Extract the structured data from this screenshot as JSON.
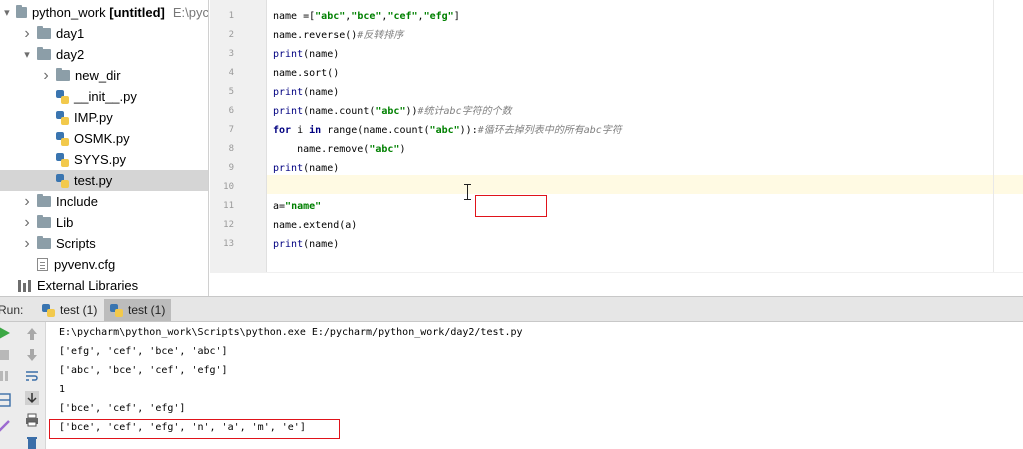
{
  "project": {
    "root_name": "python_work",
    "root_suffix": "[untitled]",
    "root_path": "E:\\pyc",
    "items": [
      {
        "label": "day1",
        "kind": "folder",
        "depth": 1,
        "expand": "collapsed"
      },
      {
        "label": "day2",
        "kind": "folder",
        "depth": 1,
        "expand": "expanded"
      },
      {
        "label": "new_dir",
        "kind": "folder",
        "depth": 2,
        "expand": "collapsed"
      },
      {
        "label": "__init__.py",
        "kind": "python",
        "depth": 2,
        "expand": "none"
      },
      {
        "label": "IMP.py",
        "kind": "python",
        "depth": 2,
        "expand": "none"
      },
      {
        "label": "OSMK.py",
        "kind": "python",
        "depth": 2,
        "expand": "none"
      },
      {
        "label": "SYYS.py",
        "kind": "python",
        "depth": 2,
        "expand": "none"
      },
      {
        "label": "test.py",
        "kind": "python",
        "depth": 2,
        "expand": "none",
        "selected": true
      },
      {
        "label": "Include",
        "kind": "folder",
        "depth": 1,
        "expand": "collapsed"
      },
      {
        "label": "Lib",
        "kind": "folder",
        "depth": 1,
        "expand": "collapsed"
      },
      {
        "label": "Scripts",
        "kind": "folder",
        "depth": 1,
        "expand": "collapsed"
      },
      {
        "label": "pyvenv.cfg",
        "kind": "config",
        "depth": 1,
        "expand": "none"
      },
      {
        "label": "External Libraries",
        "kind": "library",
        "depth": 0,
        "expand": "none"
      }
    ]
  },
  "editor": {
    "line_numbers": [
      "1",
      "2",
      "3",
      "4",
      "5",
      "6",
      "7",
      "8",
      "9",
      "10",
      "11",
      "12",
      "13"
    ],
    "current_line": 10,
    "lines": [
      [
        {
          "t": "name =[",
          "c": ""
        },
        {
          "t": "\"abc\"",
          "c": "str"
        },
        {
          "t": ",",
          "c": ""
        },
        {
          "t": "\"bce\"",
          "c": "str"
        },
        {
          "t": ",",
          "c": ""
        },
        {
          "t": "\"cef\"",
          "c": "str"
        },
        {
          "t": ",",
          "c": ""
        },
        {
          "t": "\"efg\"",
          "c": "str"
        },
        {
          "t": "]",
          "c": ""
        }
      ],
      [
        {
          "t": "name.reverse()",
          "c": ""
        },
        {
          "t": "#反转排序",
          "c": "cm"
        }
      ],
      [
        {
          "t": "print",
          "c": "fn"
        },
        {
          "t": "(name)",
          "c": ""
        }
      ],
      [
        {
          "t": "name.sort()",
          "c": ""
        }
      ],
      [
        {
          "t": "print",
          "c": "fn"
        },
        {
          "t": "(name)",
          "c": ""
        }
      ],
      [
        {
          "t": "print",
          "c": "fn"
        },
        {
          "t": "(name.count(",
          "c": ""
        },
        {
          "t": "\"abc\"",
          "c": "str"
        },
        {
          "t": "))",
          "c": ""
        },
        {
          "t": "#统计abc字符的个数",
          "c": "cm"
        }
      ],
      [
        {
          "t": "for",
          "c": "kw"
        },
        {
          "t": " i ",
          "c": ""
        },
        {
          "t": "in",
          "c": "kw"
        },
        {
          "t": " range(name.count(",
          "c": ""
        },
        {
          "t": "\"abc\"",
          "c": "str"
        },
        {
          "t": ")):",
          "c": ""
        },
        {
          "t": "#循环去掉列表中的所有abc字符",
          "c": "cm"
        }
      ],
      [
        {
          "t": "    name.remove(",
          "c": ""
        },
        {
          "t": "\"abc\"",
          "c": "str"
        },
        {
          "t": ")",
          "c": ""
        }
      ],
      [
        {
          "t": "print",
          "c": "fn"
        },
        {
          "t": "(name)",
          "c": ""
        }
      ],
      [],
      [
        {
          "t": "a=",
          "c": ""
        },
        {
          "t": "\"name\"",
          "c": "str"
        }
      ],
      [
        {
          "t": "name.extend(a)",
          "c": ""
        }
      ],
      [
        {
          "t": "print",
          "c": "fn"
        },
        {
          "t": "(name)",
          "c": ""
        }
      ]
    ]
  },
  "run": {
    "label": "Run:",
    "tabs": [
      {
        "label": "test (1)",
        "active": false
      },
      {
        "label": "test (1)",
        "active": true
      }
    ],
    "output": [
      "E:\\pycharm\\python_work\\Scripts\\python.exe E:/pycharm/python_work/day2/test.py",
      "['efg', 'cef', 'bce', 'abc']",
      "['abc', 'bce', 'cef', 'efg']",
      "1",
      "['bce', 'cef', 'efg']",
      "['bce', 'cef', 'efg', 'n', 'a', 'm', 'e']"
    ]
  },
  "colors": {
    "highlight_box": "#e0131a",
    "current_line": "#fffae3",
    "selection": "#d5d5d5",
    "keyword": "#000080",
    "string": "#008000",
    "comment": "#808080"
  }
}
